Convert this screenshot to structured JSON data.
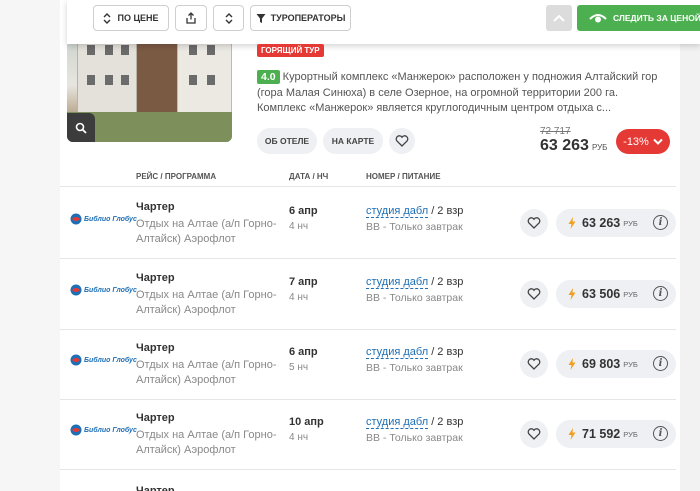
{
  "toolbar": {
    "sort_label": "ПО ЦЕНЕ",
    "operators_label": "ТУРОПЕРАТОРЫ",
    "follow_label": "СЛЕДИТЬ ЗА ЦЕНОЙ"
  },
  "hotel": {
    "badge": "ГОРЯЩИЙ ТУР",
    "rating": "4.0",
    "description": "Курортный комплекс «Манжерок» расположен у подножия Алтайский гор (гора Малая Синюха) в селе Озерное, на огромной территории 200 га. Комплекс «Манжерок» является круглогодичным центром отдыха с...",
    "about_label": "ОБ ОТЕЛЕ",
    "map_label": "НА КАРТЕ",
    "old_price": "72 717",
    "price": "63 263",
    "currency": "РУБ",
    "discount": "-13%"
  },
  "columns": {
    "flight": "РЕЙС / ПРОГРАММА",
    "date": "ДАТА / НЧ",
    "room": "НОМЕР / ПИТАНИЕ"
  },
  "offers": [
    {
      "operator_logo": "Библио Глобус",
      "type": "Чартер",
      "route": "Отдых на Алтае (а/п Горно-Алтайск) Аэрофлот",
      "date": "6 апр",
      "nights": "4 нч",
      "room": "студия дабл",
      "guests": " / 2 взр",
      "meal": "BB - Только завтрак",
      "price": "63 263",
      "currency": "РУБ"
    },
    {
      "operator_logo": "Библио Глобус",
      "type": "Чартер",
      "route": "Отдых на Алтае (а/п Горно-Алтайск) Аэрофлот",
      "date": "7 апр",
      "nights": "4 нч",
      "room": "студия дабл",
      "guests": " / 2 взр",
      "meal": "BB - Только завтрак",
      "price": "63 506",
      "currency": "РУБ"
    },
    {
      "operator_logo": "Библио Глобус",
      "type": "Чартер",
      "route": "Отдых на Алтае (а/п Горно-Алтайск) Аэрофлот",
      "date": "6 апр",
      "nights": "5 нч",
      "room": "студия дабл",
      "guests": " / 2 взр",
      "meal": "BB - Только завтрак",
      "price": "69 803",
      "currency": "РУБ"
    },
    {
      "operator_logo": "Библио Глобус",
      "type": "Чартер",
      "route": "Отдых на Алтае (а/п Горно-Алтайск) Аэрофлот",
      "date": "10 апр",
      "nights": "4 нч",
      "room": "студия дабл",
      "guests": " / 2 взр",
      "meal": "BB - Только завтрак",
      "price": "71 592",
      "currency": "РУБ"
    }
  ],
  "partial_row_type": "Чартер",
  "colors": {
    "accent_green": "#4cb050",
    "hot_red": "#e53935",
    "link_blue": "#1f6fb5"
  }
}
